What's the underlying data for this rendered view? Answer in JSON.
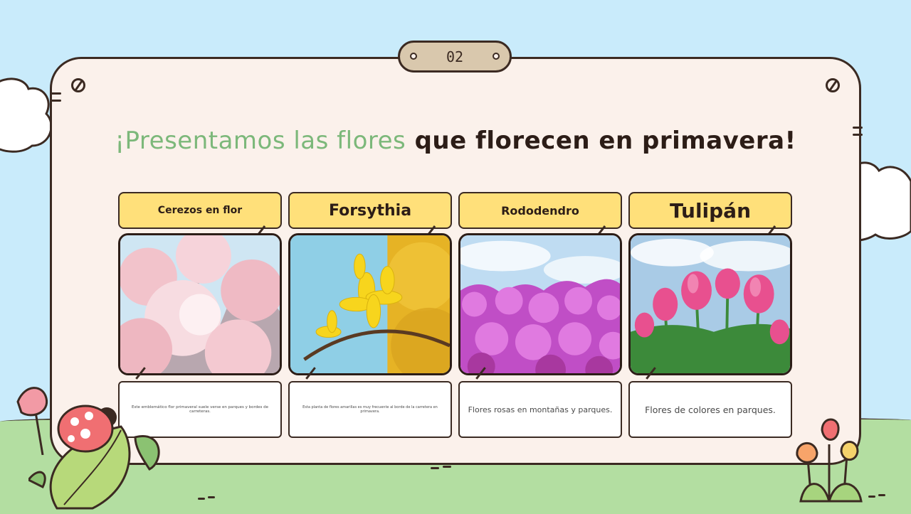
{
  "page": {
    "number": "02",
    "title_highlight": "¡Presentamos las flores",
    "title_rest": " que florecen en primavera!"
  },
  "cards": [
    {
      "label": "Cerezos en flor",
      "description": "Este emblemático flor primaveral suele verse en parques y bordes de carreteras."
    },
    {
      "label": "Forsythia",
      "description": "Esta planta de flores amarillas es muy frecuente al borde de la carretera en primavera."
    },
    {
      "label": "Rododendro",
      "description": "Flores rosas en montañas y parques."
    },
    {
      "label": "Tulipán",
      "description": "Flores de colores en parques."
    }
  ],
  "colors": {
    "sky": "#c9ebfb",
    "grass": "#b3dea1",
    "panel": "#fbf1eb",
    "label": "#ffe07a",
    "title_green": "#7cb87a",
    "outline": "#3b2a22"
  },
  "icons": [
    "cloud-icon",
    "screw-icon",
    "ladybug-icon",
    "leaf-icon",
    "tulip-icon"
  ]
}
